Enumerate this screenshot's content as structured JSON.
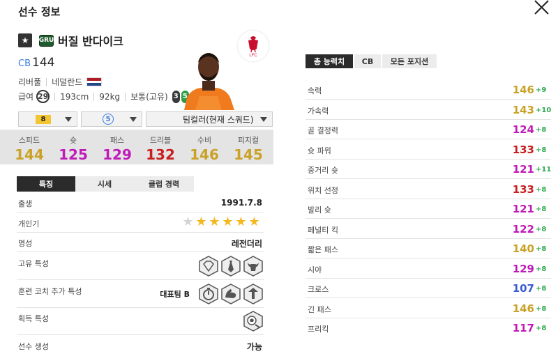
{
  "dialog": {
    "title": "선수 정보"
  },
  "player": {
    "season_badge": "GRU",
    "name": "버질 반다이크",
    "position": "CB",
    "ovr": "144",
    "club": "리버풀",
    "nation": "네덜란드",
    "salary_label": "급여",
    "salary": "29",
    "height": "193cm",
    "weight": "92kg",
    "body_type": "보통(고유)",
    "weak_foot_left": "3",
    "weak_foot_right": "5",
    "club_logo_text": "LFC"
  },
  "selectors": {
    "enhance": "8",
    "level": "5",
    "team_color": "팀컬러(현재 스쿼드)"
  },
  "summary_stats": [
    {
      "label": "스피드",
      "value": "144",
      "color": "#c9a227"
    },
    {
      "label": "슛",
      "value": "125",
      "color": "#c01bb8"
    },
    {
      "label": "패스",
      "value": "129",
      "color": "#c01bb8"
    },
    {
      "label": "드리블",
      "value": "132",
      "color": "#c81f1f"
    },
    {
      "label": "수비",
      "value": "146",
      "color": "#c9a227"
    },
    {
      "label": "피지컬",
      "value": "145",
      "color": "#c9a227"
    }
  ],
  "detail_tabs": [
    "특징",
    "시세",
    "클럽 경력"
  ],
  "details": {
    "birth_label": "출생",
    "birth": "1991.7.8",
    "popularity_label": "개인기",
    "skill_stars": 5,
    "skill_stars_max": 6,
    "reputation_label": "명성",
    "reputation": "레전더리",
    "unique_traits_label": "고유 특성",
    "coach_traits_label": "훈련 코치 추가 특성",
    "coach_traits_value": "대표팀 B",
    "acquired_traits_label": "획득 특성",
    "create_label": "선수 생성",
    "create_value": "가능"
  },
  "icons": {
    "close": "close-icon",
    "grade": "star-icon",
    "unique_traits": [
      "diamond-trait-icon",
      "tie-trait-icon",
      "bull-trait-icon"
    ],
    "coach_traits": [
      "stopwatch-trait-icon",
      "muscle-trait-icon",
      "leader-trait-icon"
    ],
    "acquired_traits": [
      "ball-trait-icon"
    ]
  },
  "right_tabs": [
    "총 능력치",
    "CB",
    "모든 포지션"
  ],
  "attributes": [
    {
      "label": "속력",
      "value": "146",
      "bonus": "+9",
      "color": "#c9a227"
    },
    {
      "label": "가속력",
      "value": "143",
      "bonus": "+10",
      "color": "#c9a227"
    },
    {
      "label": "골 결정력",
      "value": "124",
      "bonus": "+8",
      "color": "#c01bb8"
    },
    {
      "label": "슛 파워",
      "value": "133",
      "bonus": "+8",
      "color": "#c81f1f"
    },
    {
      "label": "중거리 슛",
      "value": "121",
      "bonus": "+11",
      "color": "#c01bb8"
    },
    {
      "label": "위치 선정",
      "value": "133",
      "bonus": "+8",
      "color": "#c81f1f"
    },
    {
      "label": "발리 슛",
      "value": "121",
      "bonus": "+8",
      "color": "#c01bb8"
    },
    {
      "label": "페널티 킥",
      "value": "122",
      "bonus": "+8",
      "color": "#c01bb8"
    },
    {
      "label": "짧은 패스",
      "value": "140",
      "bonus": "+8",
      "color": "#c9a227"
    },
    {
      "label": "시야",
      "value": "129",
      "bonus": "+8",
      "color": "#c01bb8"
    },
    {
      "label": "크로스",
      "value": "107",
      "bonus": "+8",
      "color": "#3b5bd6"
    },
    {
      "label": "긴 패스",
      "value": "146",
      "bonus": "+8",
      "color": "#c9a227"
    },
    {
      "label": "프리킥",
      "value": "117",
      "bonus": "+8",
      "color": "#c01bb8"
    }
  ]
}
